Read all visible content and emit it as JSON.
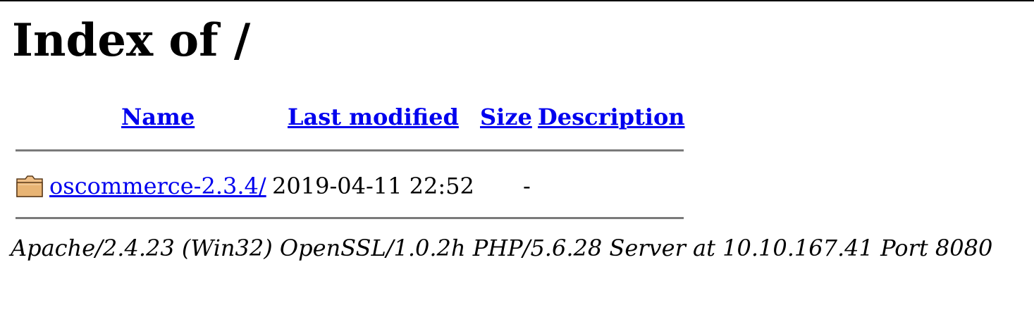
{
  "page": {
    "title": "Index of /"
  },
  "table": {
    "headers": {
      "name": "Name",
      "last_modified": "Last modified",
      "size": "Size",
      "description": "Description"
    },
    "rows": [
      {
        "icon": "folder-icon",
        "name": "oscommerce-2.3.4/",
        "last_modified": "2019-04-11 22:52",
        "size": "-",
        "description": ""
      }
    ]
  },
  "footer": {
    "address": "Apache/2.4.23 (Win32) OpenSSL/1.0.2h PHP/5.6.28 Server at 10.10.167.41 Port 8080"
  },
  "colors": {
    "link": "#0000ee",
    "rule": "#7a7a7a",
    "folder": "#e8b474"
  }
}
